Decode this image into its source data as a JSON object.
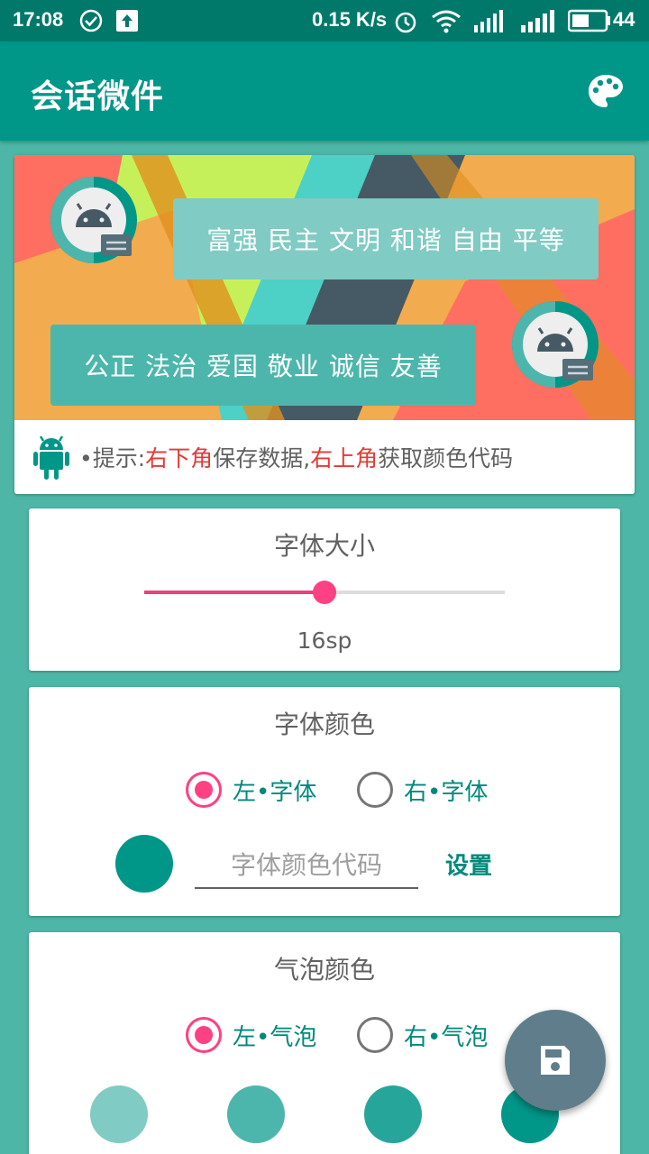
{
  "status_bar": {
    "time": "17:08",
    "net_speed": "0.15 K/s",
    "battery": "44"
  },
  "app_bar": {
    "title": "会话微件",
    "palette_icon": "palette-icon"
  },
  "banner": {
    "bubble_right_text": "富强 民主 文明 和谐 自由 平等",
    "bubble_left_text": "公正 法治 爱国 敬业 诚信 友善",
    "tip_prefix": "•提示:",
    "tip_red1": "右下角",
    "tip_mid": "保存数据,",
    "tip_red2": "右上角",
    "tip_suffix": "获取颜色代码"
  },
  "font_size": {
    "title": "字体大小",
    "value_label": "16sp",
    "slider_fraction": 0.5
  },
  "font_color": {
    "title": "字体颜色",
    "left_label": "左•字体",
    "right_label": "右•字体",
    "left_selected": true,
    "current_color": "#009688",
    "input_placeholder": "字体颜色代码",
    "set_label": "设置"
  },
  "bubble_color": {
    "title": "气泡颜色",
    "left_label": "左•气泡",
    "right_label": "右•气泡",
    "left_selected": true,
    "swatches": [
      "#80cbc4",
      "#4db6ac",
      "#26a69a",
      "#009688"
    ]
  },
  "colors": {
    "primary": "#009688",
    "primary_dark": "#00796b",
    "accent": "#ff4081",
    "background": "#4db6a6",
    "fab": "#607d8b"
  }
}
